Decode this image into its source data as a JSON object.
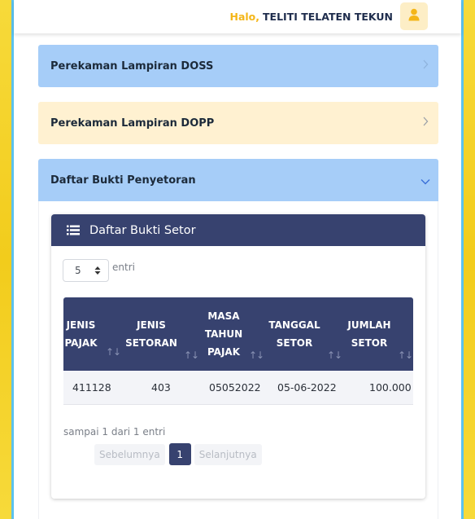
{
  "header": {
    "greeting_prefix": "Halo,",
    "user_name": "TELITI TELATEN TEKUN",
    "avatar_icon": "user-icon",
    "accent_color": "#f4b619"
  },
  "accordion": [
    {
      "label": "Perekaman Lampiran DOSS",
      "state": "collapsed"
    },
    {
      "label": "Perekaman Lampiran DOPP",
      "state": "collapsed"
    },
    {
      "label": "Daftar Bukti Penyetoran",
      "state": "expanded"
    }
  ],
  "card": {
    "title": "Daftar Bukti Setor",
    "icon": "list-icon",
    "length_menu": {
      "value": "5",
      "label": "entri"
    },
    "table": {
      "columns": [
        {
          "line1": "JENIS",
          "line2": "PAJAK",
          "line3": ""
        },
        {
          "line1": "JENIS",
          "line2": "SETORAN",
          "line3": ""
        },
        {
          "line1": "MASA",
          "line2": "TAHUN",
          "line3": "PAJAK"
        },
        {
          "line1": "TANGGAL",
          "line2": "SETOR",
          "line3": ""
        },
        {
          "line1": "JUMLAH",
          "line2": "SETOR",
          "line3": ""
        }
      ],
      "rows": [
        [
          "411128",
          "403",
          "05052022",
          "05-06-2022",
          "100.000"
        ]
      ]
    },
    "info": "sampai 1 dari 1 entri",
    "pagination": {
      "prev": "Sebelumnya",
      "current": "1",
      "next": "Selanjutnya"
    }
  }
}
